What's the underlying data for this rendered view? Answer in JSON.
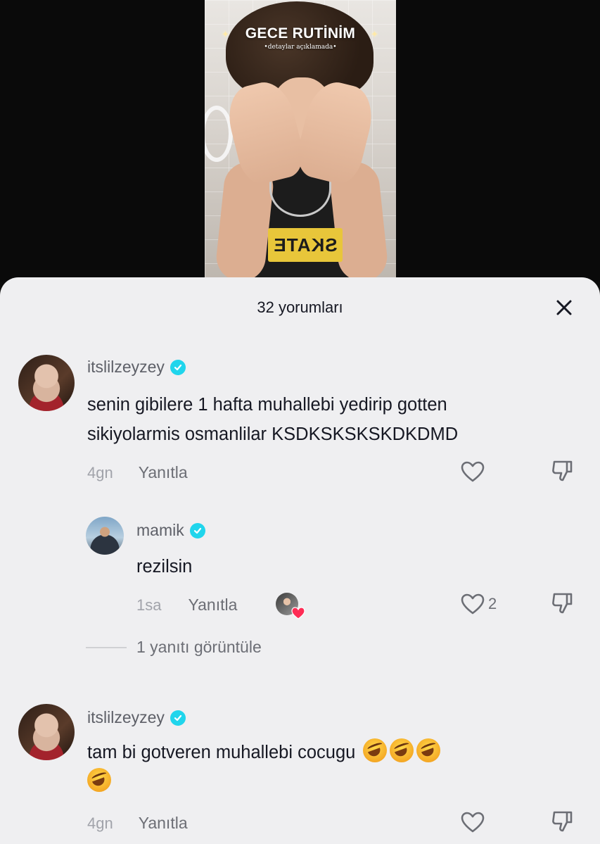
{
  "video": {
    "title": "GECE RUTİNİM",
    "subtitle": "•detaylar açıklamada•",
    "shirt_text": "SKATE"
  },
  "sheet": {
    "title": "32 yorumları",
    "close_icon": "close-icon"
  },
  "comments": [
    {
      "username": "itslilzeyzey",
      "verified": true,
      "text_line1": "senin gibilere 1 hafta muhallebi yedirip gotten",
      "text_line2": "sikiyolarmis osmanlilar KSDKSKSKSKDKDMD",
      "time": "4gn",
      "reply_label": "Yanıtla",
      "likes": ""
    },
    {
      "username": "mamik",
      "verified": true,
      "text_line1": "rezilsin",
      "time": "1sa",
      "reply_label": "Yanıtla",
      "likes": "2",
      "liked_by_creator": true
    },
    {
      "username": "itslilzeyzey",
      "verified": true,
      "text_line1": "tam bi gotveren muhallebi cocugu",
      "emoji_count": 4,
      "emoji": "rolling-on-floor-laughing",
      "time": "4gn",
      "reply_label": "Yanıtla",
      "likes": ""
    }
  ],
  "view_replies_label": "1 yanıtı görüntüle",
  "colors": {
    "sheet_bg": "#efeff1",
    "verified": "#20d5ec",
    "primary_text": "#161823",
    "secondary_text": "#6c6e75",
    "heart_red": "#fe2c55"
  }
}
